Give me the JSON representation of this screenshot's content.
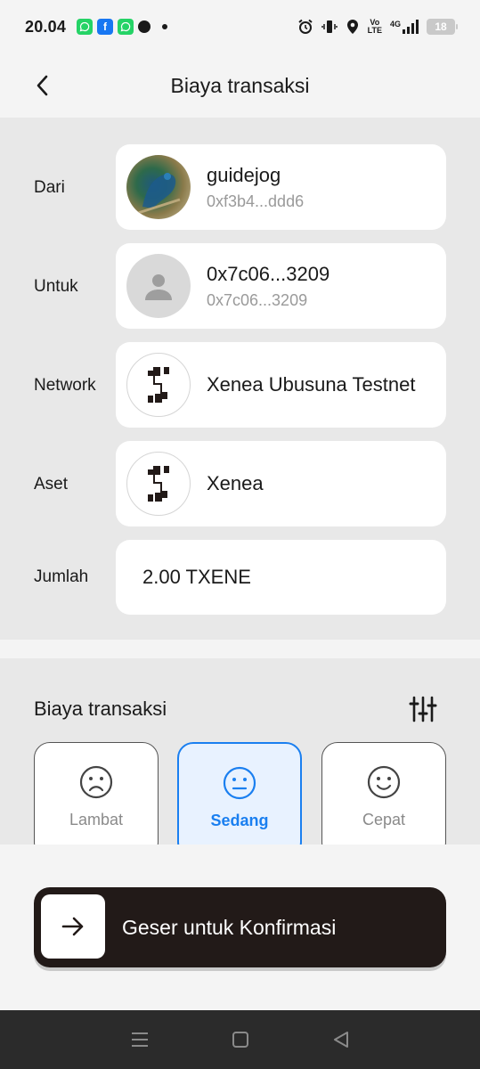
{
  "status_bar": {
    "time": "20.04",
    "notif_icons": [
      "whatsapp-icon",
      "facebook-icon",
      "whatsapp-icon",
      "message-icon"
    ],
    "volte": "Vo LTE",
    "network": "4G",
    "battery": "18"
  },
  "header": {
    "title": "Biaya transaksi"
  },
  "details": {
    "from": {
      "label": "Dari",
      "name": "guidejog",
      "address": "0xf3b4...ddd6"
    },
    "to": {
      "label": "Untuk",
      "name": "0x7c06...3209",
      "address": "0x7c06...3209"
    },
    "network": {
      "label": "Network",
      "value": "Xenea Ubusuna Testnet"
    },
    "asset": {
      "label": "Aset",
      "value": "Xenea"
    },
    "amount": {
      "label": "Jumlah",
      "value": "2.00 TXENE"
    }
  },
  "fee": {
    "title": "Biaya transaksi",
    "options": [
      {
        "label": "Lambat",
        "icon": "frown-face-icon",
        "selected": false
      },
      {
        "label": "Sedang",
        "icon": "neutral-face-icon",
        "selected": true
      },
      {
        "label": "Cepat",
        "icon": "smile-face-icon",
        "selected": false
      }
    ]
  },
  "confirm": {
    "label": "Geser untuk Konfirmasi"
  },
  "colors": {
    "accent": "#1a7ff0",
    "slider_bg": "#221a18",
    "card_bg": "#ffffff",
    "section_bg": "#e8e8e8"
  }
}
